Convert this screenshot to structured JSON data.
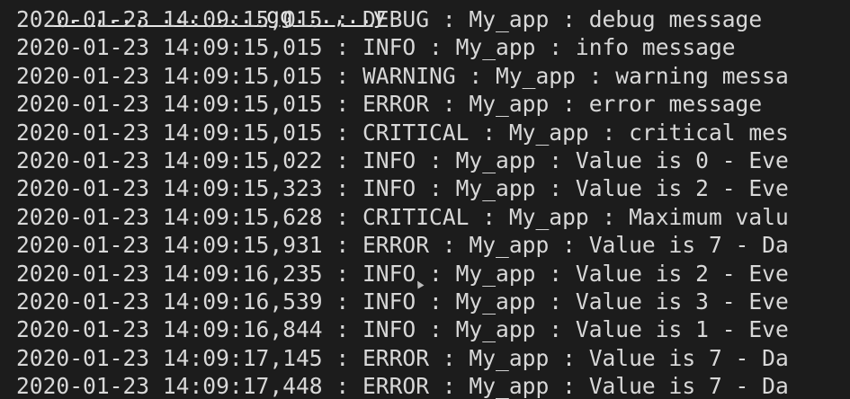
{
  "terminal": {
    "colors": {
      "background": "#1c1c1c",
      "text": "#d8d8d8",
      "prompt_green": "#5fb84a"
    },
    "prompt": {
      "text": ".. ,.., ... ....gg...,..y"
    },
    "lines": [
      "2020-01-23 14:09:15,015 : DEBUG : My_app : debug message",
      "2020-01-23 14:09:15,015 : INFO : My_app : info message",
      "2020-01-23 14:09:15,015 : WARNING : My_app : warning messa",
      "2020-01-23 14:09:15,015 : ERROR : My_app : error message",
      "2020-01-23 14:09:15,015 : CRITICAL : My_app : critical mes",
      "2020-01-23 14:09:15,022 : INFO : My_app : Value is 0 - Eve",
      "2020-01-23 14:09:15,323 : INFO : My_app : Value is 2 - Eve",
      "2020-01-23 14:09:15,628 : CRITICAL : My_app : Maximum valu",
      "2020-01-23 14:09:15,931 : ERROR : My_app : Value is 7 - Da",
      "2020-01-23 14:09:16,235 : INFO : My_app : Value is 2 - Eve",
      "2020-01-23 14:09:16,539 : INFO : My_app : Value is 3 - Eve",
      "2020-01-23 14:09:16,844 : INFO : My_app : Value is 1 - Eve",
      "2020-01-23 14:09:17,145 : ERROR : My_app : Value is 7 - Da",
      "2020-01-23 14:09:17,448 : ERROR : My_app : Value is 7 - Da"
    ],
    "cursor_icon": "mouse-pointer-icon"
  }
}
